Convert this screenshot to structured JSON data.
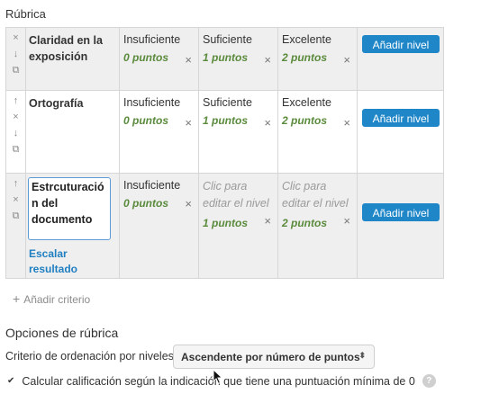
{
  "section_label": "Rúbrica",
  "criteria": [
    {
      "text": "Claridad en la exposición",
      "levels": [
        {
          "definition": "Insuficiente",
          "points": "0 puntos"
        },
        {
          "definition": "Suficiente",
          "points": "1 puntos"
        },
        {
          "definition": "Excelente",
          "points": "2 puntos"
        }
      ],
      "add_level_label": "Añadir nivel"
    },
    {
      "text": "Ortografía",
      "levels": [
        {
          "definition": "Insuficiente",
          "points": "0 puntos"
        },
        {
          "definition": "Suficiente",
          "points": "1 puntos"
        },
        {
          "definition": "Excelente",
          "points": "2 puntos"
        }
      ],
      "add_level_label": "Añadir nivel"
    },
    {
      "text": "Estrcuturación del documento",
      "scale_link": "Escalar resultado",
      "levels": [
        {
          "definition": "Insuficiente",
          "points": "0 puntos"
        },
        {
          "definition": "Clic para editar el nivel",
          "points": "1 puntos"
        },
        {
          "definition": "Clic para editar el nivel",
          "points": "2 puntos"
        }
      ],
      "add_level_label": "Añadir nivel"
    }
  ],
  "add_criterion_label": "Añadir criterio",
  "options": {
    "title": "Opciones de rúbrica",
    "sort_label": "Criterio de ordenación por niveles:",
    "sort_value": "Ascendente por número de puntos",
    "calc_label": "Calcular calificación según la indicación que tiene una puntuación mínima de 0",
    "calc_checked": true
  },
  "icons": {
    "delete": "×",
    "up": "↑",
    "down": "↓",
    "duplicate": "⧉",
    "plus": "+",
    "select_caret": "⬍",
    "check": "✔",
    "help": "?"
  },
  "colors": {
    "button_bg": "#1f87c8",
    "points_text": "#5a8a3b",
    "link": "#1f7fc1"
  }
}
